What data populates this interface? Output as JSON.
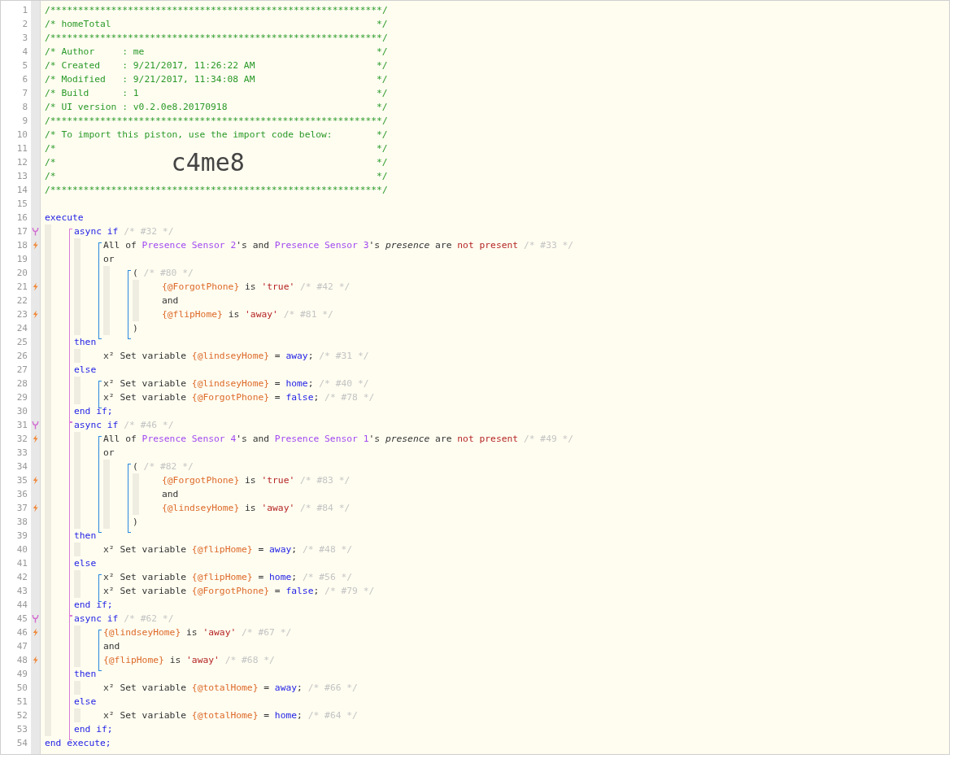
{
  "code": [
    {
      "kind": "line",
      "number": "1",
      "tokens": [
        {
          "text": "/************************************************************/",
          "kind": "header"
        }
      ]
    },
    {
      "kind": "line",
      "number": "2",
      "close": "*/",
      "tokens": [
        {
          "text": "/* homeTotal",
          "kind": "header"
        }
      ]
    },
    {
      "kind": "line",
      "number": "3",
      "tokens": [
        {
          "text": "/************************************************************/",
          "kind": "header"
        }
      ]
    },
    {
      "kind": "line",
      "number": "4",
      "close": "*/",
      "tokens": [
        {
          "text": "/* Author     : me",
          "kind": "header"
        }
      ]
    },
    {
      "kind": "line",
      "number": "5",
      "close": "*/",
      "tokens": [
        {
          "text": "/* Created    : 9/21/2017, 11:26:22 AM",
          "kind": "header"
        }
      ]
    },
    {
      "kind": "line",
      "number": "6",
      "close": "*/",
      "tokens": [
        {
          "text": "/* Modified   : 9/21/2017, 11:34:08 AM",
          "kind": "header"
        }
      ]
    },
    {
      "kind": "line",
      "number": "7",
      "close": "*/",
      "tokens": [
        {
          "text": "/* Build      : 1",
          "kind": "header"
        }
      ]
    },
    {
      "kind": "line",
      "number": "8",
      "close": "*/",
      "tokens": [
        {
          "text": "/* UI version : v0.2.0e8.20170918",
          "kind": "header"
        }
      ]
    },
    {
      "kind": "line",
      "number": "9",
      "tokens": [
        {
          "text": "/************************************************************/",
          "kind": "header"
        }
      ]
    },
    {
      "kind": "line",
      "number": "10",
      "close": "*/",
      "tokens": [
        {
          "text": "/* To import this piston, use the import code below:",
          "kind": "header"
        }
      ]
    },
    {
      "kind": "line",
      "number": "11",
      "close": "*/",
      "tokens": [
        {
          "text": "/*",
          "kind": "header"
        }
      ]
    },
    {
      "kind": "line",
      "number": "12",
      "close": "*/",
      "tokens": [
        {
          "text": "/*",
          "kind": "header"
        },
        {
          "text": "c4me8",
          "kind": "import"
        }
      ]
    },
    {
      "kind": "line",
      "number": "13",
      "close": "*/",
      "tokens": [
        {
          "text": "/*",
          "kind": "header"
        }
      ]
    },
    {
      "kind": "line",
      "number": "14",
      "tokens": [
        {
          "text": "/************************************************************/",
          "kind": "header"
        }
      ]
    },
    {
      "kind": "line",
      "number": "15"
    },
    {
      "kind": "line",
      "number": "16",
      "tokens": [
        {
          "text": "execute",
          "kind": "keyword"
        }
      ]
    },
    {
      "kind": "block",
      "children": [
        {
          "kind": "if-bracket",
          "children": [
            {
              "kind": "line",
              "number": "17",
              "async": true,
              "tokens": [
                {
                  "text": "async if",
                  "kind": "keyword"
                },
                {
                  "text": " /* #32 */",
                  "kind": "comment"
                }
              ]
            },
            {
              "kind": "block",
              "children": [
                {
                  "kind": "condition-bracket",
                  "children": [
                    {
                      "kind": "line",
                      "number": "18",
                      "trigger": true,
                      "tokens": [
                        {
                          "text": "All of ",
                          "kind": "text"
                        },
                        {
                          "text": "Presence Sensor 2",
                          "kind": "device"
                        },
                        {
                          "text": "'s and ",
                          "kind": "text"
                        },
                        {
                          "text": "Presence Sensor 3",
                          "kind": "device"
                        },
                        {
                          "text": "'s ",
                          "kind": "text"
                        },
                        {
                          "text": "presence",
                          "kind": "attribute"
                        },
                        {
                          "text": " are ",
                          "kind": "text"
                        },
                        {
                          "text": "not present",
                          "kind": "operator"
                        },
                        {
                          "text": " /* #33 */",
                          "kind": "comment"
                        }
                      ]
                    },
                    {
                      "kind": "line",
                      "number": "19",
                      "tokens": [
                        {
                          "text": "or",
                          "kind": "text"
                        }
                      ]
                    },
                    {
                      "kind": "block",
                      "children": [
                        {
                          "kind": "condition-bracket",
                          "children": [
                            {
                              "kind": "line",
                              "number": "20",
                              "tokens": [
                                {
                                  "text": "( ",
                                  "kind": "text"
                                },
                                {
                                  "text": "/* #80 */",
                                  "kind": "comment"
                                }
                              ]
                            },
                            {
                              "kind": "block",
                              "children": [
                                {
                                  "kind": "line",
                                  "number": "21",
                                  "trigger": true,
                                  "tokens": [
                                    {
                                      "text": "{@ForgotPhone}",
                                      "kind": "variable"
                                    },
                                    {
                                      "text": " is ",
                                      "kind": "text"
                                    },
                                    {
                                      "text": "'true'",
                                      "kind": "string"
                                    },
                                    {
                                      "text": " /* #42 */",
                                      "kind": "comment"
                                    }
                                  ]
                                },
                                {
                                  "kind": "line",
                                  "number": "22",
                                  "tokens": [
                                    {
                                      "text": "and",
                                      "kind": "text"
                                    }
                                  ]
                                },
                                {
                                  "kind": "line",
                                  "number": "23",
                                  "trigger": true,
                                  "tokens": [
                                    {
                                      "text": "{@flipHome}",
                                      "kind": "variable"
                                    },
                                    {
                                      "text": " is ",
                                      "kind": "text"
                                    },
                                    {
                                      "text": "'away'",
                                      "kind": "string"
                                    },
                                    {
                                      "text": " /* #81 */",
                                      "kind": "comment"
                                    }
                                  ]
                                }
                              ]
                            },
                            {
                              "kind": "line",
                              "number": "24",
                              "tokens": [
                                {
                                  "text": ")",
                                  "kind": "text"
                                }
                              ]
                            }
                          ]
                        }
                      ]
                    }
                  ]
                }
              ]
            },
            {
              "kind": "line",
              "number": "25",
              "tokens": [
                {
                  "text": "then",
                  "kind": "keyword"
                }
              ]
            },
            {
              "kind": "block",
              "children": [
                {
                  "kind": "line",
                  "number": "26",
                  "tokens": [
                    {
                      "text": "x² Set variable ",
                      "kind": "text"
                    },
                    {
                      "text": "{@lindseyHome}",
                      "kind": "variable"
                    },
                    {
                      "text": " = ",
                      "kind": "text"
                    },
                    {
                      "text": "away",
                      "kind": "value"
                    },
                    {
                      "text": ";",
                      "kind": "text"
                    },
                    {
                      "text": " /* #31 */",
                      "kind": "comment"
                    }
                  ]
                }
              ]
            },
            {
              "kind": "line",
              "number": "27",
              "tokens": [
                {
                  "text": "else",
                  "kind": "keyword"
                }
              ]
            },
            {
              "kind": "block",
              "children": [
                {
                  "kind": "condition-bracket",
                  "children": [
                    {
                      "kind": "line",
                      "number": "28",
                      "tokens": [
                        {
                          "text": "x² Set variable ",
                          "kind": "text"
                        },
                        {
                          "text": "{@lindseyHome}",
                          "kind": "variable"
                        },
                        {
                          "text": " = ",
                          "kind": "text"
                        },
                        {
                          "text": "home",
                          "kind": "value"
                        },
                        {
                          "text": ";",
                          "kind": "text"
                        },
                        {
                          "text": " /* #40 */",
                          "kind": "comment"
                        }
                      ]
                    },
                    {
                      "kind": "line",
                      "number": "29",
                      "tokens": [
                        {
                          "text": "x² Set variable ",
                          "kind": "text"
                        },
                        {
                          "text": "{@ForgotPhone}",
                          "kind": "variable"
                        },
                        {
                          "text": " = ",
                          "kind": "text"
                        },
                        {
                          "text": "false",
                          "kind": "value"
                        },
                        {
                          "text": ";",
                          "kind": "text"
                        },
                        {
                          "text": " /* #78 */",
                          "kind": "comment"
                        }
                      ]
                    }
                  ]
                }
              ]
            },
            {
              "kind": "line",
              "number": "30",
              "tokens": [
                {
                  "text": "end if;",
                  "kind": "keyword"
                }
              ]
            }
          ]
        },
        {
          "kind": "if-bracket",
          "children": [
            {
              "kind": "line",
              "number": "31",
              "async": true,
              "tokens": [
                {
                  "text": "async if",
                  "kind": "keyword"
                },
                {
                  "text": " /* #46 */",
                  "kind": "comment"
                }
              ]
            },
            {
              "kind": "block",
              "children": [
                {
                  "kind": "condition-bracket",
                  "children": [
                    {
                      "kind": "line",
                      "number": "32",
                      "trigger": true,
                      "tokens": [
                        {
                          "text": "All of ",
                          "kind": "text"
                        },
                        {
                          "text": "Presence Sensor 4",
                          "kind": "device"
                        },
                        {
                          "text": "'s and ",
                          "kind": "text"
                        },
                        {
                          "text": "Presence Sensor 1",
                          "kind": "device"
                        },
                        {
                          "text": "'s ",
                          "kind": "text"
                        },
                        {
                          "text": "presence",
                          "kind": "attribute"
                        },
                        {
                          "text": " are ",
                          "kind": "text"
                        },
                        {
                          "text": "not present",
                          "kind": "operator"
                        },
                        {
                          "text": " /* #49 */",
                          "kind": "comment"
                        }
                      ]
                    },
                    {
                      "kind": "line",
                      "number": "33",
                      "tokens": [
                        {
                          "text": "or",
                          "kind": "text"
                        }
                      ]
                    },
                    {
                      "kind": "block",
                      "children": [
                        {
                          "kind": "condition-bracket",
                          "children": [
                            {
                              "kind": "line",
                              "number": "34",
                              "tokens": [
                                {
                                  "text": "( ",
                                  "kind": "text"
                                },
                                {
                                  "text": "/* #82 */",
                                  "kind": "comment"
                                }
                              ]
                            },
                            {
                              "kind": "block",
                              "children": [
                                {
                                  "kind": "line",
                                  "number": "35",
                                  "trigger": true,
                                  "tokens": [
                                    {
                                      "text": "{@ForgotPhone}",
                                      "kind": "variable"
                                    },
                                    {
                                      "text": " is ",
                                      "kind": "text"
                                    },
                                    {
                                      "text": "'true'",
                                      "kind": "string"
                                    },
                                    {
                                      "text": " /* #83 */",
                                      "kind": "comment"
                                    }
                                  ]
                                },
                                {
                                  "kind": "line",
                                  "number": "36",
                                  "tokens": [
                                    {
                                      "text": "and",
                                      "kind": "text"
                                    }
                                  ]
                                },
                                {
                                  "kind": "line",
                                  "number": "37",
                                  "trigger": true,
                                  "tokens": [
                                    {
                                      "text": "{@lindseyHome}",
                                      "kind": "variable"
                                    },
                                    {
                                      "text": " is ",
                                      "kind": "text"
                                    },
                                    {
                                      "text": "'away'",
                                      "kind": "string"
                                    },
                                    {
                                      "text": " /* #84 */",
                                      "kind": "comment"
                                    }
                                  ]
                                }
                              ]
                            },
                            {
                              "kind": "line",
                              "number": "38",
                              "tokens": [
                                {
                                  "text": ")",
                                  "kind": "text"
                                }
                              ]
                            }
                          ]
                        }
                      ]
                    }
                  ]
                }
              ]
            },
            {
              "kind": "line",
              "number": "39",
              "tokens": [
                {
                  "text": "then",
                  "kind": "keyword"
                }
              ]
            },
            {
              "kind": "block",
              "children": [
                {
                  "kind": "line",
                  "number": "40",
                  "tokens": [
                    {
                      "text": "x² Set variable ",
                      "kind": "text"
                    },
                    {
                      "text": "{@flipHome}",
                      "kind": "variable"
                    },
                    {
                      "text": " = ",
                      "kind": "text"
                    },
                    {
                      "text": "away",
                      "kind": "value"
                    },
                    {
                      "text": ";",
                      "kind": "text"
                    },
                    {
                      "text": " /* #48 */",
                      "kind": "comment"
                    }
                  ]
                }
              ]
            },
            {
              "kind": "line",
              "number": "41",
              "tokens": [
                {
                  "text": "else",
                  "kind": "keyword"
                }
              ]
            },
            {
              "kind": "block",
              "children": [
                {
                  "kind": "condition-bracket",
                  "children": [
                    {
                      "kind": "line",
                      "number": "42",
                      "tokens": [
                        {
                          "text": "x² Set variable ",
                          "kind": "text"
                        },
                        {
                          "text": "{@flipHome}",
                          "kind": "variable"
                        },
                        {
                          "text": " = ",
                          "kind": "text"
                        },
                        {
                          "text": "home",
                          "kind": "value"
                        },
                        {
                          "text": ";",
                          "kind": "text"
                        },
                        {
                          "text": " /* #56 */",
                          "kind": "comment"
                        }
                      ]
                    },
                    {
                      "kind": "line",
                      "number": "43",
                      "tokens": [
                        {
                          "text": "x² Set variable ",
                          "kind": "text"
                        },
                        {
                          "text": "{@ForgotPhone}",
                          "kind": "variable"
                        },
                        {
                          "text": " = ",
                          "kind": "text"
                        },
                        {
                          "text": "false",
                          "kind": "value"
                        },
                        {
                          "text": ";",
                          "kind": "text"
                        },
                        {
                          "text": " /* #79 */",
                          "kind": "comment"
                        }
                      ]
                    }
                  ]
                }
              ]
            },
            {
              "kind": "line",
              "number": "44",
              "tokens": [
                {
                  "text": "end if;",
                  "kind": "keyword"
                }
              ]
            }
          ]
        },
        {
          "kind": "if-bracket",
          "children": [
            {
              "kind": "line",
              "number": "45",
              "async": true,
              "tokens": [
                {
                  "text": "async if",
                  "kind": "keyword"
                },
                {
                  "text": " /* #62 */",
                  "kind": "comment"
                }
              ]
            },
            {
              "kind": "block",
              "children": [
                {
                  "kind": "condition-bracket",
                  "children": [
                    {
                      "kind": "line",
                      "number": "46",
                      "trigger": true,
                      "tokens": [
                        {
                          "text": "{@lindseyHome}",
                          "kind": "variable"
                        },
                        {
                          "text": " is ",
                          "kind": "text"
                        },
                        {
                          "text": "'away'",
                          "kind": "string"
                        },
                        {
                          "text": " /* #67 */",
                          "kind": "comment"
                        }
                      ]
                    },
                    {
                      "kind": "line",
                      "number": "47",
                      "tokens": [
                        {
                          "text": "and",
                          "kind": "text"
                        }
                      ]
                    },
                    {
                      "kind": "line",
                      "number": "48",
                      "trigger": true,
                      "tokens": [
                        {
                          "text": "{@flipHome}",
                          "kind": "variable"
                        },
                        {
                          "text": " is ",
                          "kind": "text"
                        },
                        {
                          "text": "'away'",
                          "kind": "string"
                        },
                        {
                          "text": " /* #68 */",
                          "kind": "comment"
                        }
                      ]
                    }
                  ]
                }
              ]
            },
            {
              "kind": "line",
              "number": "49",
              "tokens": [
                {
                  "text": "then",
                  "kind": "keyword"
                }
              ]
            },
            {
              "kind": "block",
              "children": [
                {
                  "kind": "line",
                  "number": "50",
                  "tokens": [
                    {
                      "text": "x² Set variable ",
                      "kind": "text"
                    },
                    {
                      "text": "{@totalHome}",
                      "kind": "variable"
                    },
                    {
                      "text": " = ",
                      "kind": "text"
                    },
                    {
                      "text": "away",
                      "kind": "value"
                    },
                    {
                      "text": ";",
                      "kind": "text"
                    },
                    {
                      "text": " /* #66 */",
                      "kind": "comment"
                    }
                  ]
                }
              ]
            },
            {
              "kind": "line",
              "number": "51",
              "tokens": [
                {
                  "text": "else",
                  "kind": "keyword"
                }
              ]
            },
            {
              "kind": "block",
              "children": [
                {
                  "kind": "line",
                  "number": "52",
                  "tokens": [
                    {
                      "text": "x² Set variable ",
                      "kind": "text"
                    },
                    {
                      "text": "{@totalHome}",
                      "kind": "variable"
                    },
                    {
                      "text": " = ",
                      "kind": "text"
                    },
                    {
                      "text": "home",
                      "kind": "value"
                    },
                    {
                      "text": ";",
                      "kind": "text"
                    },
                    {
                      "text": " /* #64 */",
                      "kind": "comment"
                    }
                  ]
                }
              ]
            },
            {
              "kind": "line",
              "number": "53",
              "tokens": [
                {
                  "text": "end if;",
                  "kind": "keyword"
                }
              ]
            }
          ]
        }
      ]
    },
    {
      "kind": "line",
      "number": "54",
      "tokens": [
        {
          "text": "end execute;",
          "kind": "keyword"
        }
      ]
    }
  ]
}
